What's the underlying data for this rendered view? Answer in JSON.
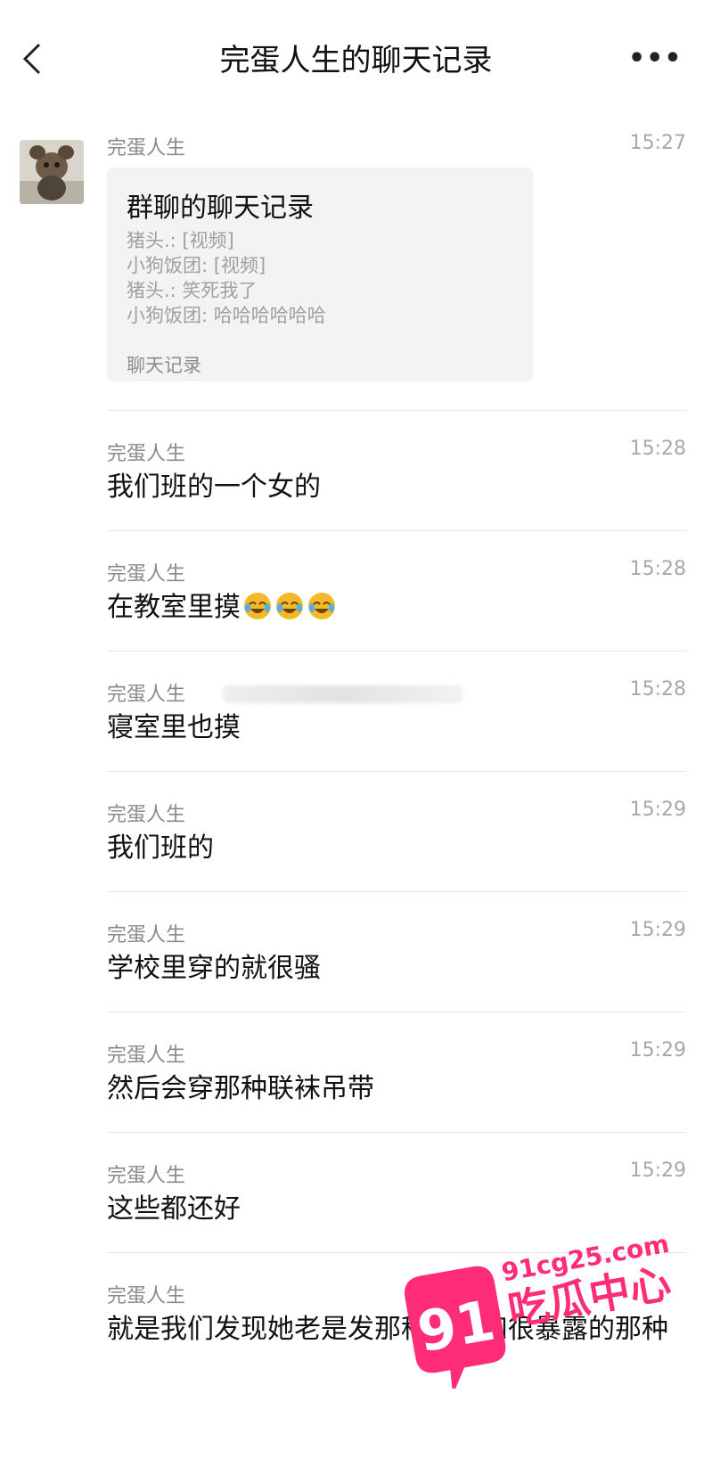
{
  "header": {
    "title": "完蛋人生的聊天记录",
    "more_label": "•••"
  },
  "forwarded_card": {
    "sender": "完蛋人生",
    "time": "15:27",
    "title": "群聊的聊天记录",
    "lines": [
      "猪头.: [视频]",
      "小狗饭团: [视频]",
      "猪头.: 笑死我了",
      "小狗饭团: 哈哈哈哈哈哈"
    ],
    "footer": "聊天记录"
  },
  "messages": [
    {
      "sender": "完蛋人生",
      "time": "15:28",
      "text": "我们班的一个女的"
    },
    {
      "sender": "完蛋人生",
      "time": "15:28",
      "text": "在教室里摸"
    },
    {
      "sender": "完蛋人生",
      "time": "15:28",
      "text": "寝室里也摸"
    },
    {
      "sender": "完蛋人生",
      "time": "15:29",
      "text": "我们班的"
    },
    {
      "sender": "完蛋人生",
      "time": "15:29",
      "text": "学校里穿的就很骚"
    },
    {
      "sender": "完蛋人生",
      "time": "15:29",
      "text": "然后会穿那种联袜吊带"
    },
    {
      "sender": "完蛋人生",
      "time": "15:29",
      "text": "这些都还好"
    },
    {
      "sender": "完蛋人生",
      "time": "",
      "text": "就是我们发现她老是发那种机照和很暴露的那种"
    }
  ],
  "emoji": {
    "name": "laughing-crying-emoji",
    "count": 3
  },
  "watermark": {
    "number": "91",
    "domain": "91cg25.com",
    "name": "吃瓜中心",
    "color": "#ff2d78"
  }
}
